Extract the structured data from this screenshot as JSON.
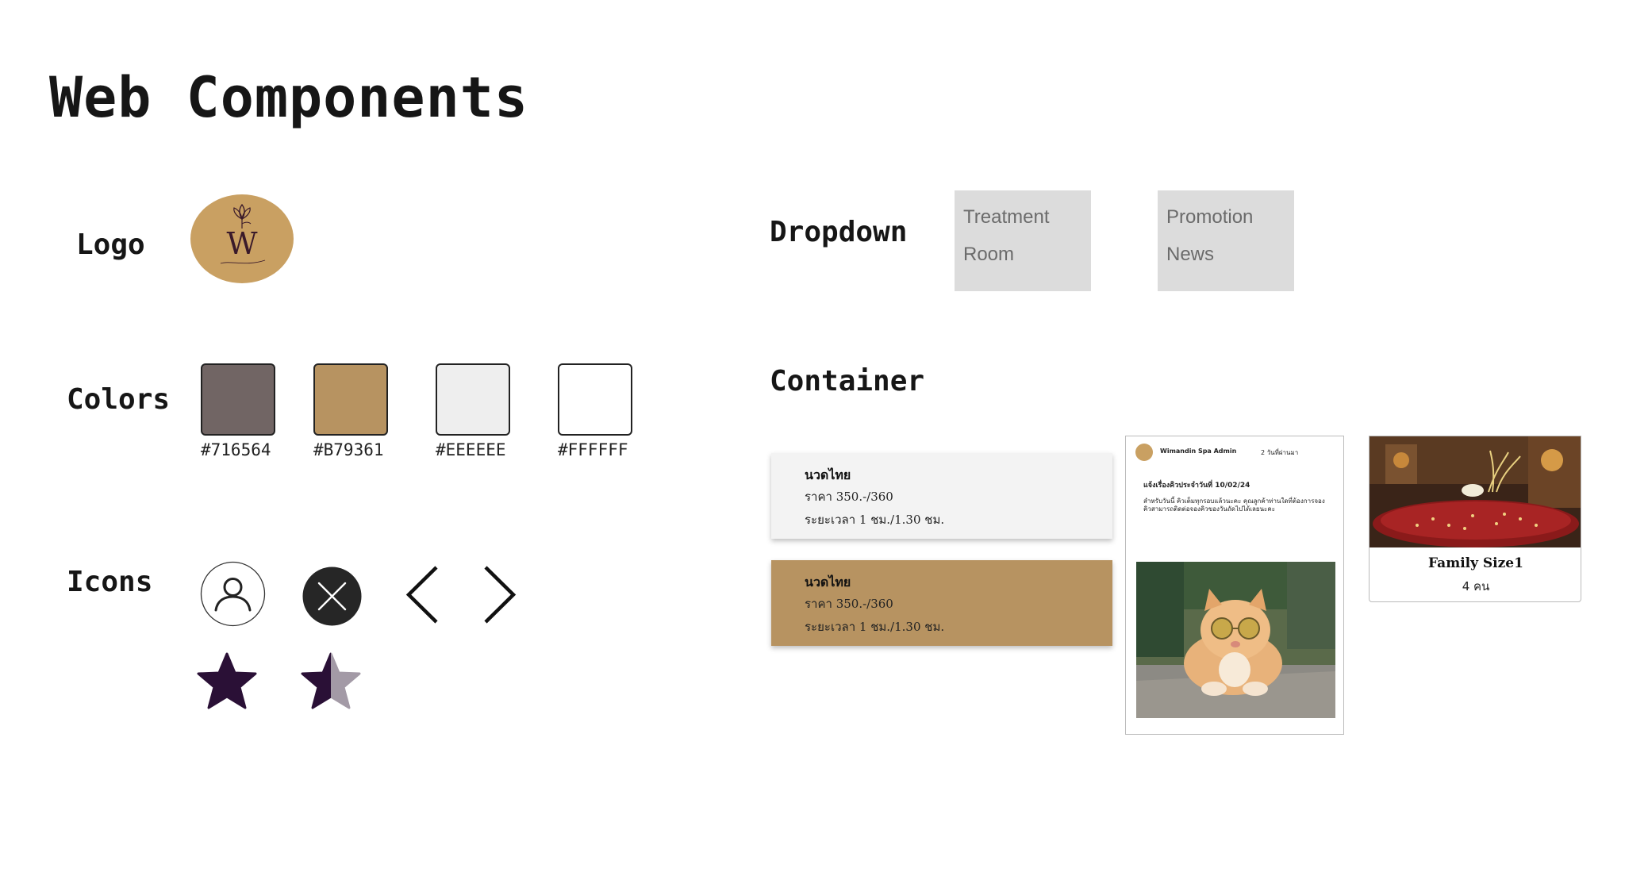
{
  "page": {
    "title": "Web Components"
  },
  "logo": {
    "label": "Logo"
  },
  "colors": {
    "label": "Colors",
    "swatches": [
      {
        "hex": "#716564",
        "fill": "#716564"
      },
      {
        "hex": "#B79361",
        "fill": "#B79361"
      },
      {
        "hex": "#EEEEEE",
        "fill": "#EEEEEE"
      },
      {
        "hex": "#FFFFFF",
        "fill": "#FFFFFF"
      }
    ]
  },
  "icons": {
    "label": "Icons",
    "items": [
      "user-icon",
      "close-icon",
      "chevron-left-icon",
      "chevron-right-icon",
      "star-full-icon",
      "star-half-icon"
    ],
    "star_color": "#2a1036"
  },
  "dropdown": {
    "label": "Dropdown",
    "menus": [
      {
        "items": [
          "Treatment",
          "Room"
        ]
      },
      {
        "items": [
          "Promotion",
          "News"
        ]
      }
    ]
  },
  "container": {
    "label": "Container",
    "service_cards": [
      {
        "name": "นวดไทย",
        "price": "ราคา 350.-/360",
        "duration": "ระยะเวลา 1 ชม./1.30 ชม.",
        "bg": "#f3f3f3"
      },
      {
        "name": "นวดไทย",
        "price": "ราคา 350.-/360",
        "duration": "ระยะเวลา 1 ชม./1.30 ชม.",
        "bg": "#b79361"
      }
    ],
    "post_card": {
      "author": "Wimandin Spa Admin",
      "time": "2 วันที่ผ่านมา",
      "headline": "แจ้งเรื่องคิวประจำวันที่ 10/02/24",
      "body": "สำหรับวันนี้ คิวเต็มทุกรอบแล้วนะคะ คุณลูกค้าท่านใดที่ต้องการจองคิวสามารถติดต่อจองคิวของวันถัดไปได้เลยนะคะ",
      "image_alt": "cat-photo"
    },
    "room_card": {
      "title": "Family Size1",
      "capacity": "4 คน",
      "image_alt": "spa-room-photo"
    }
  }
}
